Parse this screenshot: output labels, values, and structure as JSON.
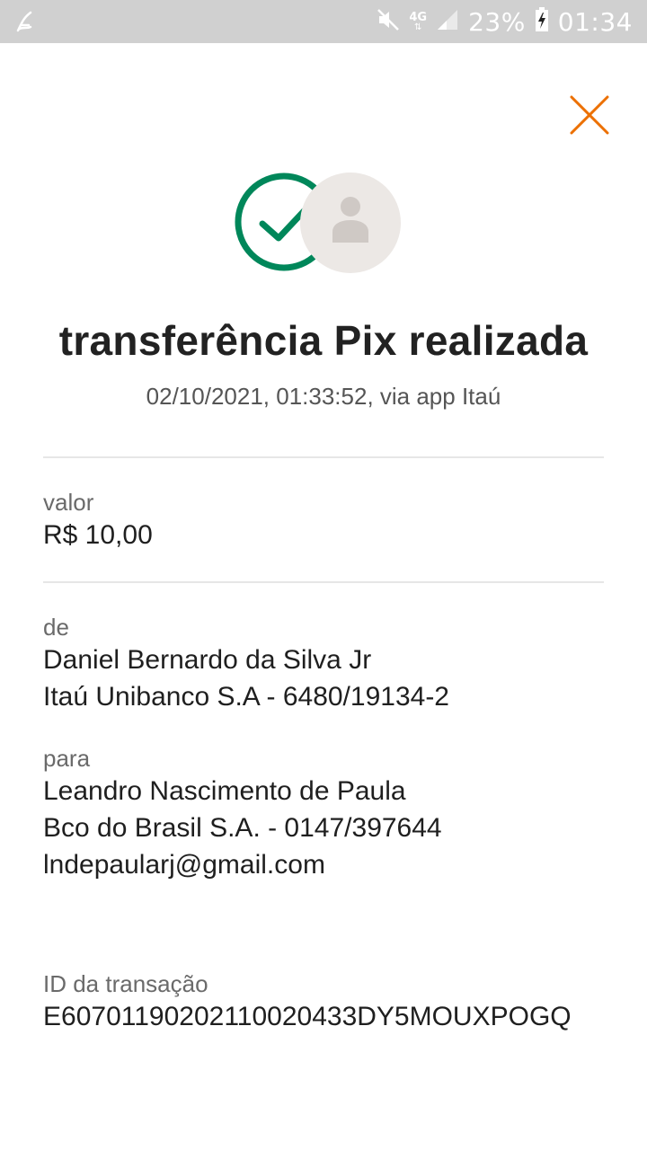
{
  "status_bar": {
    "network": "4G",
    "battery": "23%",
    "time": "01:34",
    "icons": [
      "notification-icon",
      "mute-icon",
      "signal-icon",
      "battery-charging-icon"
    ]
  },
  "header": {
    "close_icon": "close-icon",
    "accent_color": "#ec7000"
  },
  "hero": {
    "title": "transferência Pix realizada",
    "subtitle": "02/10/2021,  01:33:52, via app Itaú",
    "success_color": "#00875a"
  },
  "valor": {
    "label": "valor",
    "amount": "R$ 10,00"
  },
  "de": {
    "label": "de",
    "name": "Daniel Bernardo da Silva Jr",
    "bank": "Itaú Unibanco S.A - 6480/19134-2"
  },
  "para": {
    "label": "para",
    "name": "Leandro Nascimento de Paula",
    "bank": "Bco do Brasil S.A. - 0147/397644",
    "key": "lndepaularj@gmail.com"
  },
  "transacao": {
    "label": "ID da transação",
    "id": "E60701190202110020433DY5MOUXPOGQ"
  }
}
